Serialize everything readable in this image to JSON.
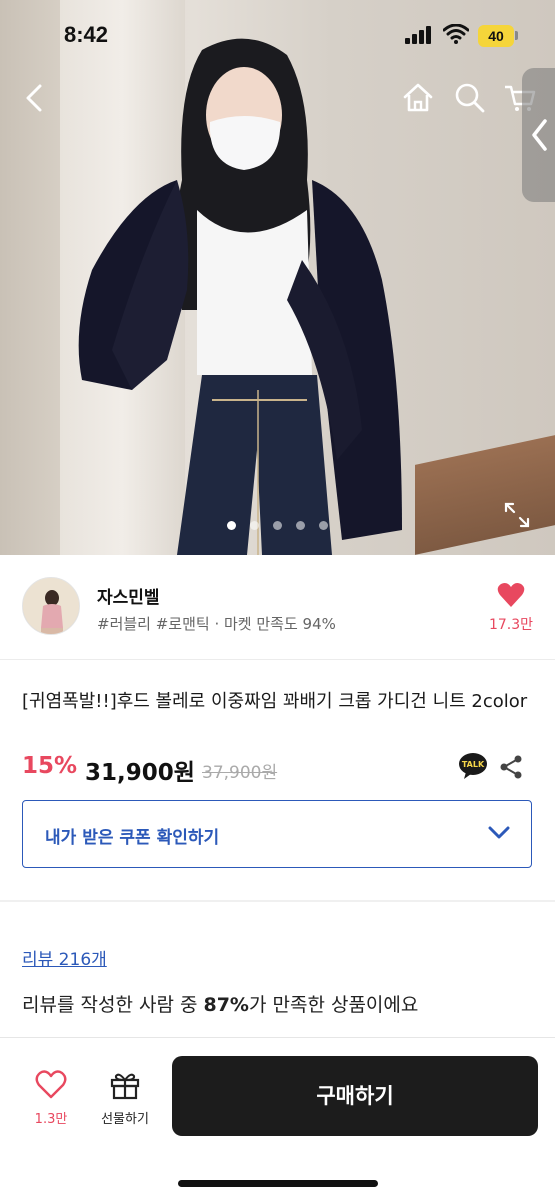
{
  "status_bar": {
    "time": "8:42",
    "battery": "40"
  },
  "header": {
    "icons": [
      "back-arrow-icon",
      "home-icon",
      "search-icon",
      "cart-icon",
      "side-panel-chevron-icon"
    ]
  },
  "gallery": {
    "image_count": 5,
    "active_index": 0
  },
  "seller": {
    "name": "자스민벨",
    "tags": "#러블리 #로맨틱 · 마켓 만족도 94%",
    "likes": "17.3만"
  },
  "product": {
    "title": "[귀염폭발!!]후드 볼레로 이중짜임 꽈배기 크롭 가디건 니트 2color",
    "discount": "15%",
    "price": "31,900원",
    "original_price": "37,900원",
    "coupon_label": "내가 받은 쿠폰 확인하기"
  },
  "review": {
    "link": "리뷰 216개",
    "summary_prefix": "리뷰를 작성한 사람 중 ",
    "summary_percent": "87%",
    "summary_suffix": "가 만족한 상품이에요"
  },
  "bottom_bar": {
    "wish_count": "1.3만",
    "gift_label": "선물하기",
    "buy_label": "구매하기"
  },
  "colors": {
    "accent_red": "#e8485f",
    "link_blue": "#2c59b9",
    "buy_button": "#1c1c1c",
    "battery": "#f5d53a"
  }
}
